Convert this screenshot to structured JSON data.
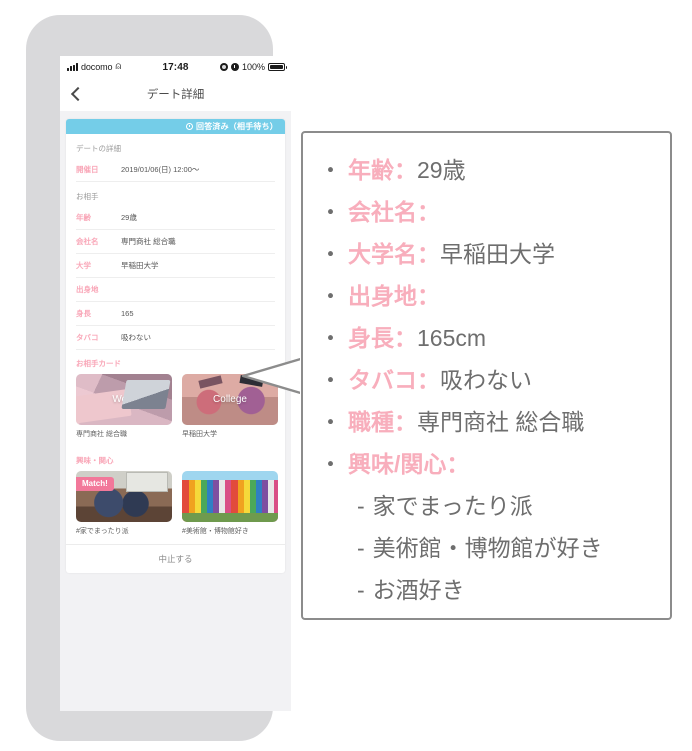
{
  "phone": {
    "status_bar": {
      "carrier": "docomo",
      "time": "17:48",
      "battery_percent": "100%",
      "icons": [
        "signal-bars-icon",
        "wifi-icon",
        "location-arrow-icon",
        "alarm-icon",
        "battery-icon"
      ]
    },
    "nav": {
      "back_icon": "chevron-left-icon",
      "title": "デート詳細"
    },
    "status_banner": {
      "icon": "clock-icon",
      "text": "回答済み（相手待ち）",
      "color": "#74cde8"
    },
    "sections": [
      {
        "heading": "デートの詳細",
        "rows": [
          {
            "label": "開催日",
            "value": "2019/01/06(日) 12:00〜"
          }
        ]
      },
      {
        "heading": "お相手",
        "rows": [
          {
            "label": "年齢",
            "value": "29歳"
          },
          {
            "label": "会社名",
            "value": "専門商社 総合職"
          },
          {
            "label": "大学",
            "value": "早稲田大学"
          },
          {
            "label": "出身地",
            "value": ""
          },
          {
            "label": "身長",
            "value": "165"
          },
          {
            "label": "タバコ",
            "value": "吸わない"
          }
        ]
      }
    ],
    "partner_cards": {
      "title": "お相手カード",
      "items": [
        {
          "overlay_label": "Work",
          "caption": "専門商社 総合職",
          "badge": ""
        },
        {
          "overlay_label": "College",
          "caption": "早稲田大学",
          "badge": ""
        }
      ]
    },
    "interests": {
      "title": "興味・関心",
      "items": [
        {
          "overlay_label": "",
          "caption": "#家でまったり派",
          "badge": "Match!"
        },
        {
          "overlay_label": "",
          "caption": "#美術館・博物館好き",
          "badge": ""
        }
      ]
    },
    "bottom_action": {
      "label": "中止する"
    }
  },
  "callout": {
    "items": [
      {
        "key": "年齢",
        "sep": "：",
        "value": "29歳"
      },
      {
        "key": "会社名",
        "sep": "：",
        "value": ""
      },
      {
        "key": "大学名",
        "sep": "：",
        "value": "早稲田大学"
      },
      {
        "key": "出身地",
        "sep": "：",
        "value": ""
      },
      {
        "key": "身長",
        "sep": "：",
        "value": "165cm"
      },
      {
        "key": "タバコ",
        "sep": "：",
        "value": "吸わない"
      },
      {
        "key": "職種",
        "sep": "：",
        "value": "専門商社 総合職"
      },
      {
        "key": "興味/関心",
        "sep": "：",
        "value": ""
      }
    ],
    "sub_items": [
      {
        "dash": "-",
        "text": "家でまったり派"
      },
      {
        "dash": "-",
        "text": "美術館・博物館が好き"
      },
      {
        "dash": "-",
        "text": "お酒好き"
      }
    ],
    "key_color": "#f8aebc",
    "text_color": "#6e6e6e",
    "border_color": "#8c8c8c"
  }
}
